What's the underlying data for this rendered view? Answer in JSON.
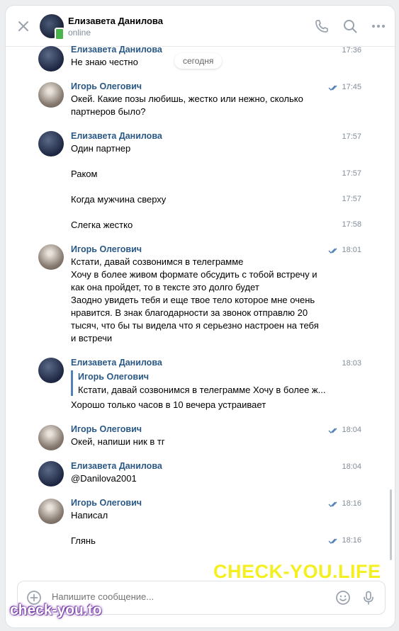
{
  "header": {
    "name": "Елизавета Данилова",
    "status": "online"
  },
  "date_pill": "сегодня",
  "messages": [
    {
      "author": "Елизавета Данилова",
      "time": "17:36",
      "text": "Не знаю честно"
    },
    {
      "author": "Игорь Олегович",
      "time": "17:45",
      "text": "Окей. Какие позы любишь, жестко или нежно, сколько партнеров было?"
    },
    {
      "author": "Елизавета Данилова",
      "time": "17:57",
      "text": "Один партнер"
    },
    {
      "time": "17:57",
      "text": "Раком"
    },
    {
      "time": "17:57",
      "text": "Когда мужчина сверху"
    },
    {
      "time": "17:58",
      "text": "Слегка жестко"
    },
    {
      "author": "Игорь Олегович",
      "time": "18:01",
      "text": "Кстати, давай созвонимся в телеграмме\nХочу в более живом формате обсудить с тобой встречу и как она пройдет, то в тексте это долго будет\nЗаодно увидеть тебя и еще твое тело которое мне очень нравится. В знак благодарности за звонок отправлю 20 тысяч, что бы ты видела что я серьезно настроен на тебя и встречи"
    },
    {
      "author": "Елизавета Данилова",
      "time": "18:03",
      "reply_author": "Игорь Олегович",
      "reply_text": "Кстати, давай созвонимся в телеграмме Хочу в более ж...",
      "text": "Хорошо только часов в 10 вечера устраивает"
    },
    {
      "author": "Игорь Олегович",
      "time": "18:04",
      "text": "Окей, напиши ник в тг"
    },
    {
      "author": "Елизавета Данилова",
      "time": "18:04",
      "text": "@Danilova2001"
    },
    {
      "author": "Игорь Олегович",
      "time": "18:16",
      "text": "Написал"
    },
    {
      "time": "18:16",
      "text": "Глянь"
    }
  ],
  "composer": {
    "placeholder": "Напишите сообщение..."
  },
  "watermarks": {
    "top": "CHECK-YOU.LIFE",
    "bottom": "check-you.to"
  },
  "colors": {
    "author": "#2a5885",
    "online": "#4bb34b",
    "read_check": "#5181b8",
    "watermark_yellow": "#f4ef1f",
    "watermark_purple": "#7a3fa8"
  },
  "icons": [
    "close-icon",
    "phone-icon",
    "search-icon",
    "more-icon",
    "double-check-icon",
    "plus-icon",
    "emoji-icon",
    "mic-icon"
  ]
}
